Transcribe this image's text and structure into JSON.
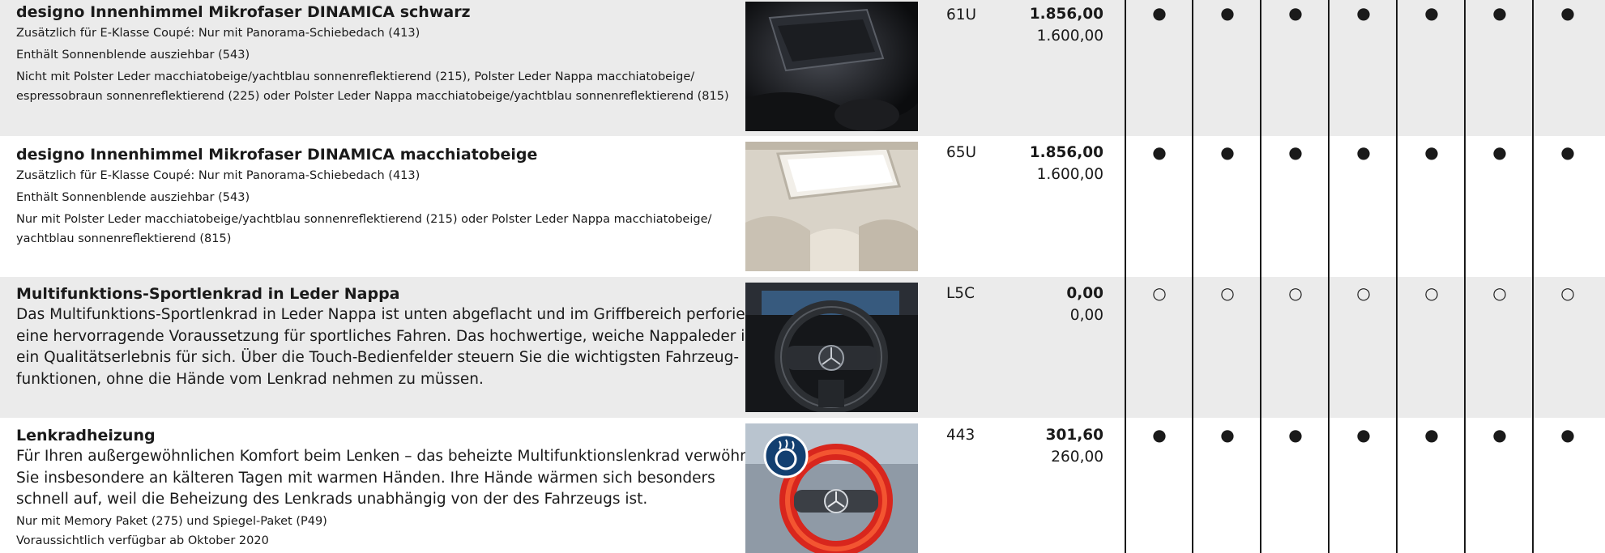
{
  "rows": [
    {
      "title": "designo Innenhimmel Mikrofaser DINAMICA schwarz",
      "lines": [
        "Zusätzlich für E-Klasse Coupé: Nur mit Panorama-Schiebedach (413)",
        "Enthält Sonnenblende ausziehbar (543)",
        "Nicht mit Polster Leder macchiatobeige/yachtblau sonnenreflektierend (215), Polster Leder Nappa macchiatobeige/",
        "espressobraun sonnenreflektierend (225) oder Polster Leder Nappa macchiatobeige/yachtblau sonnenreflektierend (815)"
      ],
      "code": "61U",
      "price_gross": "1.856,00",
      "price_net": "1.600,00",
      "availability": "●",
      "image": "schwarzer Dachhimmel mit Panorama-Schiebedach"
    },
    {
      "title": "designo Innenhimmel Mikrofaser DINAMICA macchiatobeige",
      "lines": [
        "Zusätzlich für E-Klasse Coupé: Nur mit Panorama-Schiebedach (413)",
        "Enthält Sonnenblende ausziehbar (543)",
        "Nur mit Polster Leder macchiatobeige/yachtblau sonnenreflektierend (215) oder Polster Leder Nappa macchiatobeige/",
        "yachtblau sonnenreflektierend (815)"
      ],
      "code": "65U",
      "price_gross": "1.856,00",
      "price_net": "1.600,00",
      "availability": "●",
      "image": "heller Dachhimmel mit Schiebedach"
    },
    {
      "title": "Multifunktions-Sportlenkrad in Leder Nappa",
      "body": [
        "Das Multifunktions-Sportlenkrad in Leder Nappa ist unten abgeflacht und im Griffbereich perforiert –",
        "eine hervorragende Voraussetzung für sportliches Fahren. Das hochwertige, weiche Nappaleder ist",
        "ein Qualitätserlebnis für sich. Über die Touch-Bedienfelder steuern Sie die wichtigsten Fahrzeug-",
        "funktionen, ohne die Hände vom Lenkrad nehmen zu müssen."
      ],
      "code": "L5C",
      "price_gross": "0,00",
      "price_net": "0,00",
      "availability": "○",
      "image": "Multifunktions-Sportlenkrad"
    },
    {
      "title": "Lenkradheizung",
      "body": [
        "Für Ihren außergewöhnlichen Komfort beim Lenken – das beheizte Multifunktionslenkrad verwöhnt",
        "Sie insbesondere an kälteren Tagen mit warmen Händen. Ihre Hände wärmen sich besonders",
        "schnell auf, weil die Beheizung des Lenkrads unabhängig von der des Fahrzeugs ist."
      ],
      "lines": [
        "Nur mit Memory Paket (275) und Spiegel-Paket (P49)",
        "Voraussichtlich verfügbar ab Oktober 2020"
      ],
      "code": "443",
      "price_gross": "301,60",
      "price_net": "260,00",
      "availability": "●",
      "image": "beheiztes Lenkrad"
    }
  ]
}
